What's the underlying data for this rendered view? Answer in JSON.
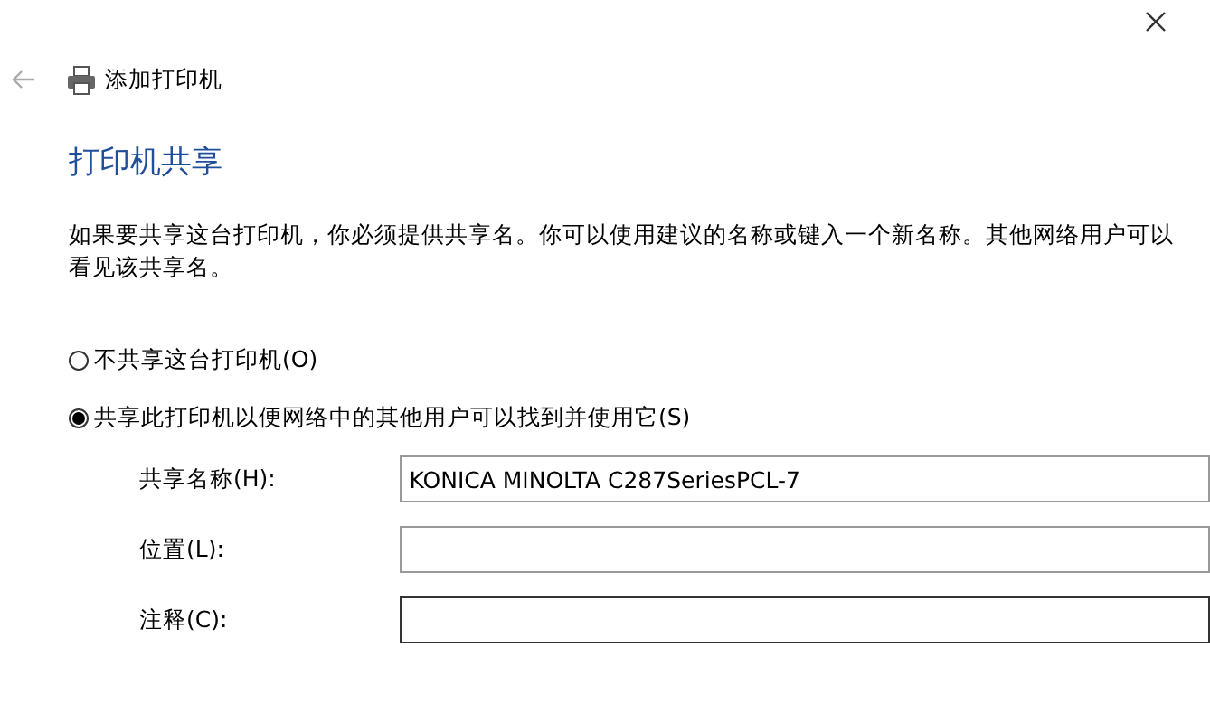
{
  "window": {
    "title": "添加打印机"
  },
  "heading": "打印机共享",
  "description": "如果要共享这台打印机，你必须提供共享名。你可以使用建议的名称或键入一个新名称。其他网络用户可以看见该共享名。",
  "options": [
    {
      "label": "不共享这台打印机(O)",
      "selected": false
    },
    {
      "label": "共享此打印机以便网络中的其他用户可以找到并使用它(S)",
      "selected": true
    }
  ],
  "fields": [
    {
      "label": "共享名称(H):",
      "value": "KONICA MINOLTA C287SeriesPCL-7",
      "focused": false
    },
    {
      "label": "位置(L):",
      "focused": false
    },
    {
      "label": "注释(C):",
      "focused": true
    }
  ]
}
